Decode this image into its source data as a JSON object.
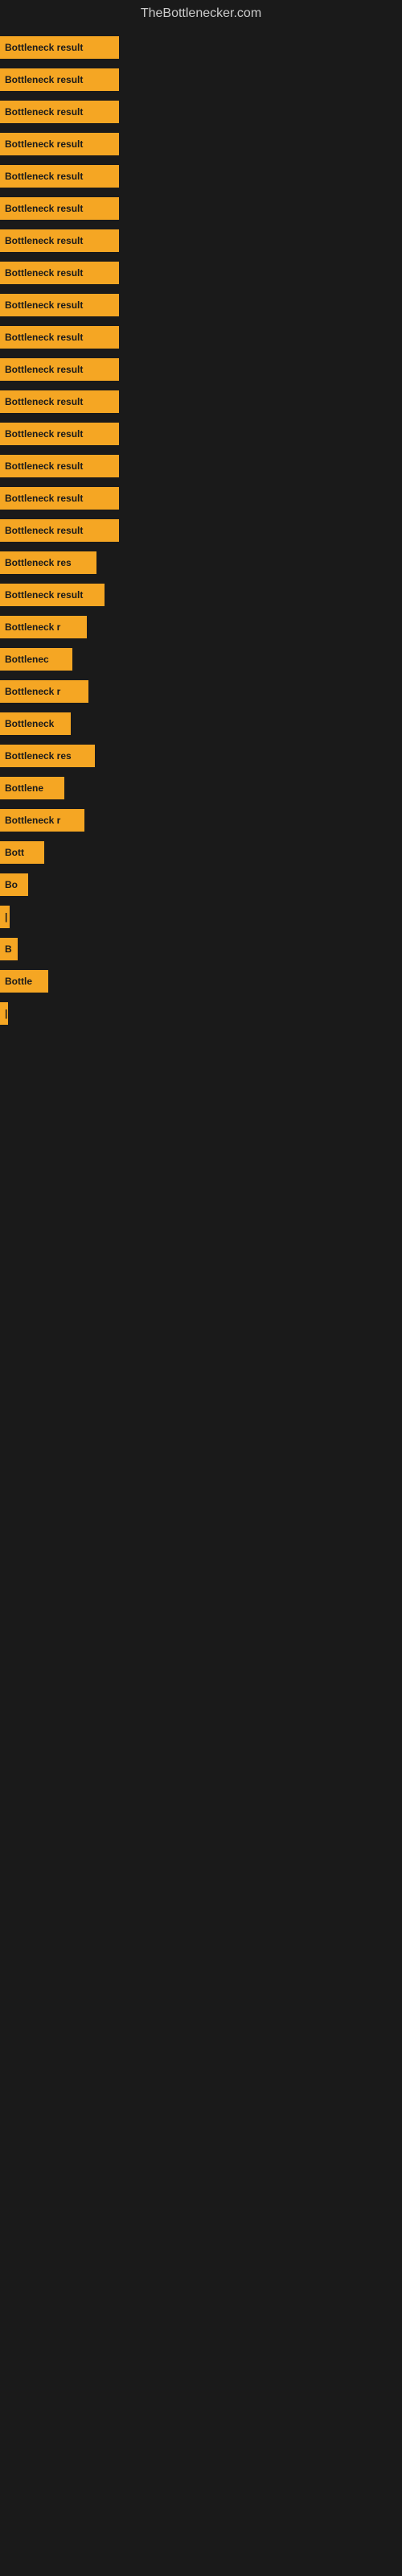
{
  "site": {
    "title": "TheBottlenecker.com"
  },
  "bars": [
    {
      "label": "Bottleneck result",
      "width": 148
    },
    {
      "label": "Bottleneck result",
      "width": 148
    },
    {
      "label": "Bottleneck result",
      "width": 148
    },
    {
      "label": "Bottleneck result",
      "width": 148
    },
    {
      "label": "Bottleneck result",
      "width": 148
    },
    {
      "label": "Bottleneck result",
      "width": 148
    },
    {
      "label": "Bottleneck result",
      "width": 148
    },
    {
      "label": "Bottleneck result",
      "width": 148
    },
    {
      "label": "Bottleneck result",
      "width": 148
    },
    {
      "label": "Bottleneck result",
      "width": 148
    },
    {
      "label": "Bottleneck result",
      "width": 148
    },
    {
      "label": "Bottleneck result",
      "width": 148
    },
    {
      "label": "Bottleneck result",
      "width": 148
    },
    {
      "label": "Bottleneck result",
      "width": 148
    },
    {
      "label": "Bottleneck result",
      "width": 148
    },
    {
      "label": "Bottleneck result",
      "width": 148
    },
    {
      "label": "Bottleneck res",
      "width": 120
    },
    {
      "label": "Bottleneck result",
      "width": 130
    },
    {
      "label": "Bottleneck r",
      "width": 108
    },
    {
      "label": "Bottlenec",
      "width": 90
    },
    {
      "label": "Bottleneck r",
      "width": 110
    },
    {
      "label": "Bottleneck",
      "width": 88
    },
    {
      "label": "Bottleneck res",
      "width": 118
    },
    {
      "label": "Bottlene",
      "width": 80
    },
    {
      "label": "Bottleneck r",
      "width": 105
    },
    {
      "label": "Bott",
      "width": 55
    },
    {
      "label": "Bo",
      "width": 35
    },
    {
      "label": "|",
      "width": 12
    },
    {
      "label": "B",
      "width": 22
    },
    {
      "label": "Bottle",
      "width": 60
    },
    {
      "label": "|",
      "width": 10
    }
  ]
}
